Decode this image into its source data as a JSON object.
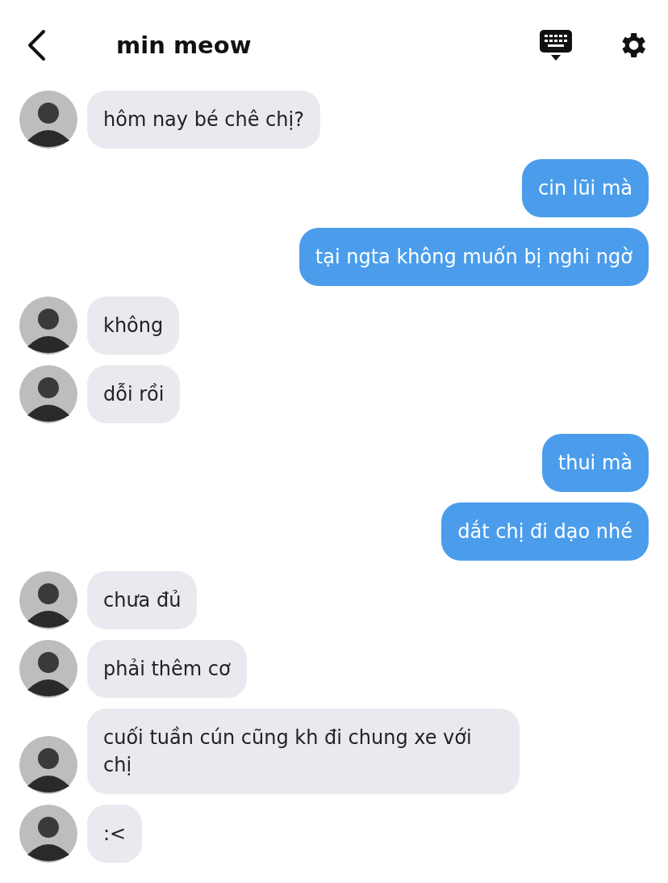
{
  "header": {
    "title": "min meow"
  },
  "messages": [
    {
      "kind": "received",
      "text": "hôm nay bé chê chị?"
    },
    {
      "kind": "sent",
      "text": "cin lũi mà"
    },
    {
      "kind": "sent",
      "text": "tại ngta không muốn bị nghi ngờ"
    },
    {
      "kind": "received",
      "text": "không"
    },
    {
      "kind": "received",
      "text": "dỗi rồi"
    },
    {
      "kind": "sent",
      "text": "thui mà"
    },
    {
      "kind": "sent",
      "text": "dắt chị đi dạo nhé"
    },
    {
      "kind": "received",
      "text": "chưa đủ"
    },
    {
      "kind": "received",
      "text": "phải thêm cơ"
    },
    {
      "kind": "received",
      "text": "cuối tuần cún cũng kh đi chung xe với chị"
    },
    {
      "kind": "received",
      "text": ":<"
    }
  ]
}
